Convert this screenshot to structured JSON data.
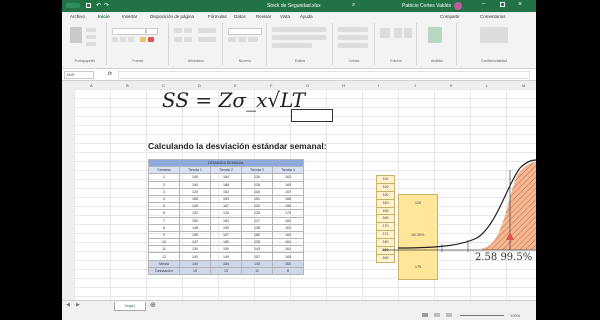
{
  "window": {
    "title": "Stock de Seguridad.xlsx",
    "user": "Patricio Cortes Valdés"
  },
  "menu": {
    "tabs": [
      "Archivo",
      "Inicio",
      "Insertar",
      "Disposición de página",
      "Fórmulas",
      "Datos",
      "Revisar",
      "Vista",
      "Ayuda"
    ],
    "share_label": "Compartir",
    "comments_label": "Comentarios"
  },
  "ribbon": {
    "groups": [
      "Portapapeles",
      "Fuente",
      "Alineación",
      "Número",
      "Estilos",
      "Celdas",
      "Edición",
      "Análisis",
      "Confidencialidad"
    ]
  },
  "name_box": "H19",
  "formula": "SS = Zσ_x√LT",
  "heading": "Calculando la desviación estándar semanal:",
  "table": {
    "title": "DEMANDA SEMANAL",
    "columns": [
      "Semana",
      "Tienda 1",
      "Tienda 2",
      "Tienda 3",
      "Tienda 4"
    ],
    "rows": [
      [
        "1",
        "140",
        "184",
        "130",
        "161"
      ],
      [
        "2",
        "154",
        "188",
        "128",
        "160"
      ],
      [
        "3",
        "120",
        "152",
        "140",
        "157"
      ],
      [
        "4",
        "168",
        "153",
        "151",
        "166"
      ],
      [
        "5",
        "125",
        "167",
        "120",
        "150"
      ],
      [
        "6",
        "132",
        "134",
        "135",
        "170"
      ],
      [
        "7",
        "150",
        "163",
        "127",
        "161"
      ],
      [
        "8",
        "148",
        "159",
        "138",
        "161"
      ],
      [
        "9",
        "136",
        "167",
        "180",
        "160"
      ],
      [
        "10",
        "147",
        "180",
        "125",
        "161"
      ],
      [
        "11",
        "130",
        "150",
        "143",
        "161"
      ],
      [
        "12",
        "140",
        "149",
        "157",
        "165"
      ]
    ],
    "summary": [
      [
        "Media",
        "140",
        "164",
        "140",
        "160"
      ],
      [
        "Desviación",
        "10",
        "13",
        "11",
        "6"
      ]
    ]
  },
  "yellow_values": [
    "110",
    "120",
    "130",
    "140",
    "150",
    "160",
    "170",
    "171",
    "140",
    "150",
    "160"
  ],
  "yellow_labels": [
    "125",
    "66.30%",
    "175"
  ],
  "normal_label": "2.58  99.5%",
  "sheet_tab": "Hoja1",
  "zoom": "100%",
  "colors": {
    "excel_green": "#217346",
    "curve_fill": "#f4b183",
    "cell_yellow": "#fff2cc",
    "header_blue": "#d9e1f2"
  }
}
